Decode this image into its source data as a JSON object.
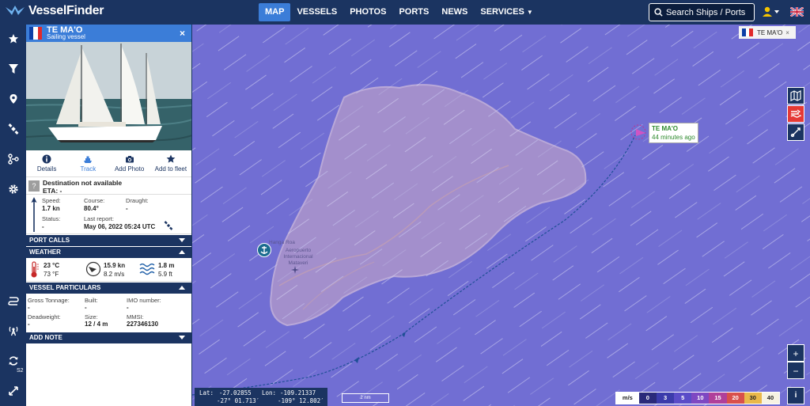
{
  "app": {
    "name": "VesselFinder"
  },
  "nav": [
    {
      "label": "MAP",
      "active": true
    },
    {
      "label": "VESSELS"
    },
    {
      "label": "PHOTOS"
    },
    {
      "label": "PORTS"
    },
    {
      "label": "NEWS"
    },
    {
      "label": "SERVICES"
    }
  ],
  "search": {
    "placeholder": "Search Ships / Ports"
  },
  "sidebar": {
    "s2": "S2"
  },
  "vessel": {
    "name": "TE MA'O",
    "type": "Sailing vessel",
    "actions": [
      {
        "label": "Details"
      },
      {
        "label": "Track"
      },
      {
        "label": "Add Photo"
      },
      {
        "label": "Add to fleet"
      }
    ],
    "destination": "Destination not available",
    "eta": "ETA: -",
    "speed_label": "Speed:",
    "speed": "1.7 kn",
    "course_label": "Course:",
    "course": "80.4°",
    "draught_label": "Draught:",
    "draught": "-",
    "status_label": "Status:",
    "status": "-",
    "last_report_label": "Last report:",
    "last_report": "May 06, 2022 05:24 UTC"
  },
  "sections": {
    "port_calls": "PORT CALLS",
    "weather": "WEATHER",
    "particulars": "VESSEL PARTICULARS",
    "add_note": "ADD NOTE"
  },
  "weather": {
    "temp_c": "23 °C",
    "temp_f": "73 °F",
    "wind_kn": "15.9 kn",
    "wind_ms": "8.2 m/s",
    "wave_m": "1.8 m",
    "wave_ft": "5.9 ft"
  },
  "particulars": {
    "gross_label": "Gross Tonnage:",
    "gross": "-",
    "built_label": "Built:",
    "built": "-",
    "imo_label": "IMO number:",
    "imo": "-",
    "dw_label": "Deadweight:",
    "dw": "-",
    "size_label": "Size:",
    "size": "12 / 4 m",
    "mmsi_label": "MMSI:",
    "mmsi": "227346130"
  },
  "map": {
    "tab_name": "TE MA'O",
    "vessel_label_name": "TE MA'O",
    "vessel_label_time": "44 minutes ago",
    "place_name": "Hanga Roa",
    "airport": "Aeropuerto Internacional Mataveri",
    "zoom_in": "+",
    "zoom_out": "−",
    "info": "i",
    "lat_label": "Lat:",
    "lat_dec": "-27.02855",
    "lat_dms": "-27° 01.713′",
    "lon_label": "Lon:",
    "lon_dec": "-109.21337",
    "lon_dms": "-109° 12.802′",
    "scale": "2 nm"
  },
  "legend": {
    "unit": "m/s",
    "items": [
      {
        "v": "0",
        "bg": "#2a2a7a",
        "fg": "#ffffff"
      },
      {
        "v": "3",
        "bg": "#3b3bab",
        "fg": "#ffffff"
      },
      {
        "v": "5",
        "bg": "#5a4cc8",
        "fg": "#ffffff"
      },
      {
        "v": "10",
        "bg": "#7e48c2",
        "fg": "#ffffff"
      },
      {
        "v": "15",
        "bg": "#b0409a",
        "fg": "#ffffff"
      },
      {
        "v": "20",
        "bg": "#d9504b",
        "fg": "#ffffff"
      },
      {
        "v": "30",
        "bg": "#e9b84a",
        "fg": "#222222"
      },
      {
        "v": "40",
        "bg": "#f6f2e2",
        "fg": "#222222"
      }
    ]
  },
  "colors": {
    "navy": "#1b3461",
    "accent": "#3b7dd8",
    "map_sea": "#716ed3"
  }
}
